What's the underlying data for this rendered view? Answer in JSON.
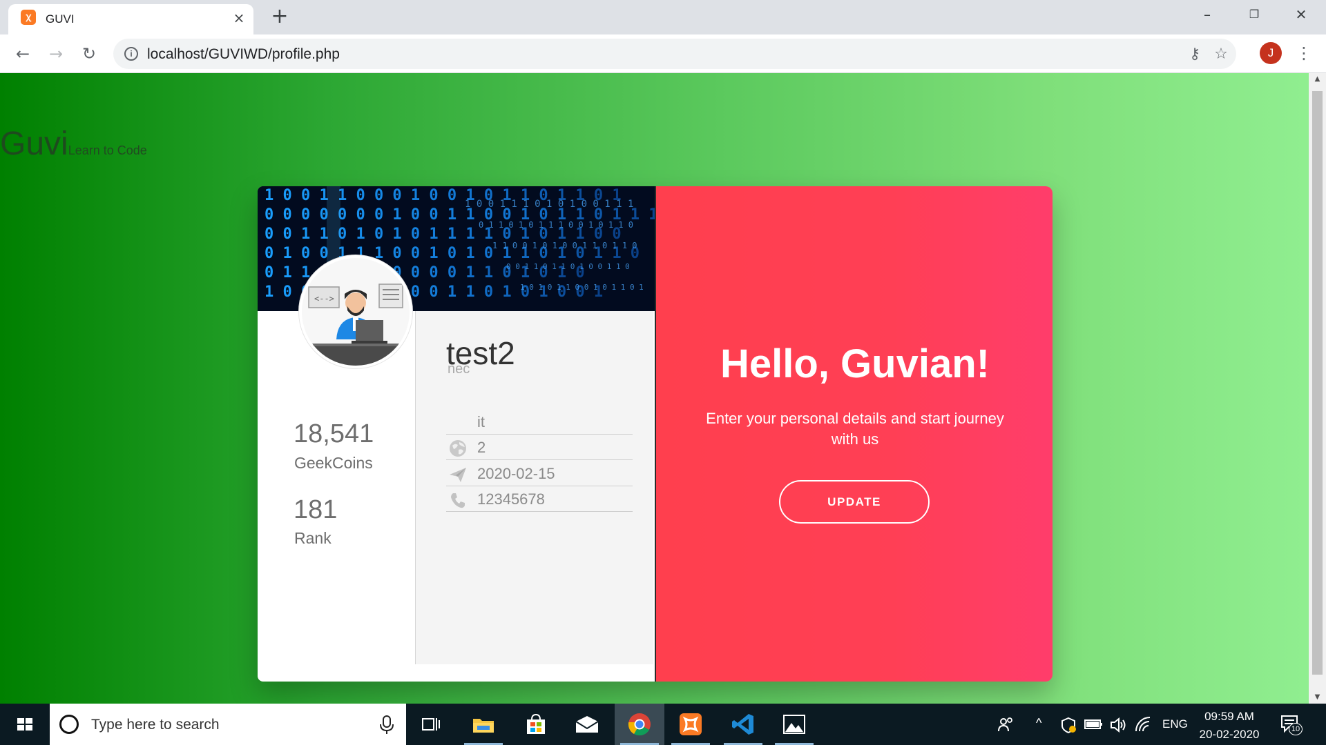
{
  "browser": {
    "tab_title": "GUVI",
    "tab_favicon": "xampp-icon",
    "tab_close": "×",
    "new_tab": "+",
    "url": "localhost/GUVIWD/profile.php",
    "profile_initial": "J"
  },
  "page": {
    "brand_name": "Guvi",
    "brand_tagline": "Learn to Code",
    "profile": {
      "username": "test2",
      "college": "nec",
      "details": [
        {
          "icon": "none",
          "value": "it"
        },
        {
          "icon": "globe-icon",
          "value": "2"
        },
        {
          "icon": "paper-plane-icon",
          "value": "2020-02-15"
        },
        {
          "icon": "phone-icon",
          "value": "12345678"
        }
      ],
      "stats": [
        {
          "value": "18,541",
          "label": "GeekCoins"
        },
        {
          "value": "181",
          "label": "Rank"
        }
      ]
    },
    "welcome": {
      "title": "Hello, Guvian!",
      "subtitle": "Enter your personal details and start journey with us",
      "button_label": "UPDATE"
    },
    "colors": {
      "gradient_start": "#008000",
      "gradient_end": "#90ee90",
      "accent": "#ff4154"
    }
  },
  "taskbar": {
    "search_placeholder": "Type here to search",
    "language": "ENG",
    "time": "09:59 AM",
    "date": "20-02-2020",
    "notification_count": "10"
  }
}
